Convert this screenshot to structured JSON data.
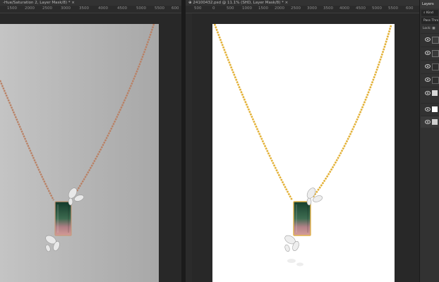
{
  "documents": [
    {
      "tab_prefix": "",
      "tab_title": "-Hue/Saturation 2, Layer Mask/8) *",
      "tab_close": "×",
      "ruler_ticks": [
        "1500",
        "2000",
        "2500",
        "3000",
        "3500",
        "4000",
        "4500",
        "5000",
        "5500",
        "600"
      ]
    },
    {
      "tab_prefix": "⊕",
      "tab_title": "24100432.psd @ 11.1% (SHD, Layer Mask/8) *",
      "tab_close": "×",
      "ruler_ticks": [
        "500",
        "0",
        "500",
        "1000",
        "1500",
        "2000",
        "2500",
        "3000",
        "3500",
        "4000",
        "4500",
        "5000",
        "5500",
        "600"
      ]
    }
  ],
  "layers_panel": {
    "tab": "Layers",
    "kind_filter": "Kind",
    "blend_mode": "Pass Thro",
    "lock_label": "Lock:",
    "layer_count": 7
  },
  "colors": {
    "chain_rose": "#b98064",
    "chain_gold": "#e3b137",
    "gem_top": "#1c4a34",
    "gem_bottom": "#c98d8e",
    "left_bg": "#b8b8b8",
    "right_bg": "#ffffff"
  }
}
